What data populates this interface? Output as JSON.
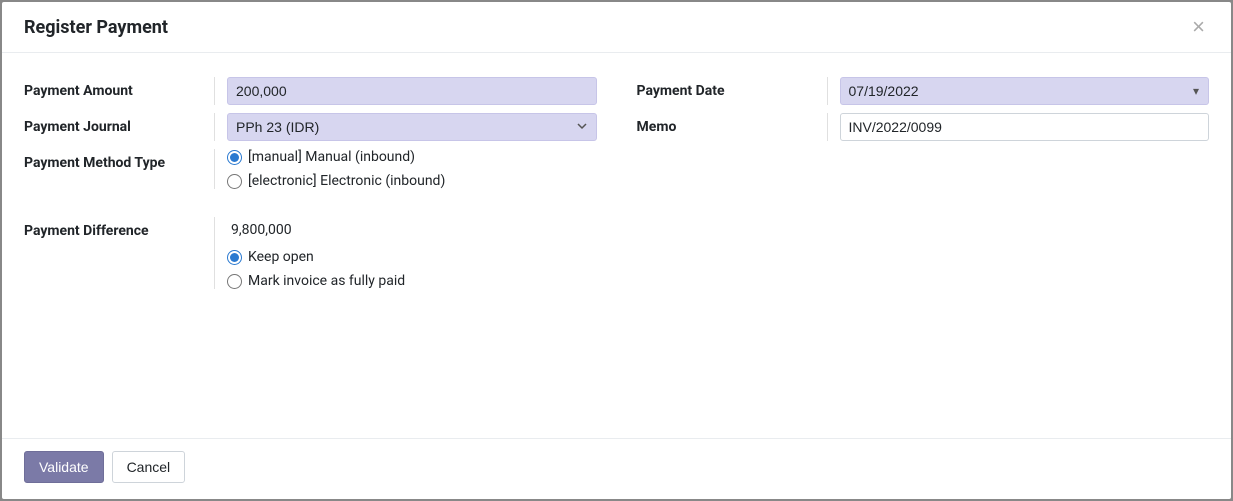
{
  "modal": {
    "title": "Register Payment"
  },
  "form": {
    "payment_amount": {
      "label": "Payment Amount",
      "value": "200,000"
    },
    "payment_journal": {
      "label": "Payment Journal",
      "value": "PPh 23 (IDR)"
    },
    "payment_method_type": {
      "label": "Payment Method Type",
      "options": {
        "manual": "[manual] Manual (inbound)",
        "electronic": "[electronic] Electronic (inbound)"
      },
      "selected": "manual"
    },
    "payment_date": {
      "label": "Payment Date",
      "value": "07/19/2022"
    },
    "memo": {
      "label": "Memo",
      "value": "INV/2022/0099"
    },
    "payment_difference": {
      "label": "Payment Difference",
      "value": "9,800,000",
      "options": {
        "keep_open": "Keep open",
        "fully_paid": "Mark invoice as fully paid"
      },
      "selected": "keep_open"
    }
  },
  "footer": {
    "validate": "Validate",
    "cancel": "Cancel"
  }
}
